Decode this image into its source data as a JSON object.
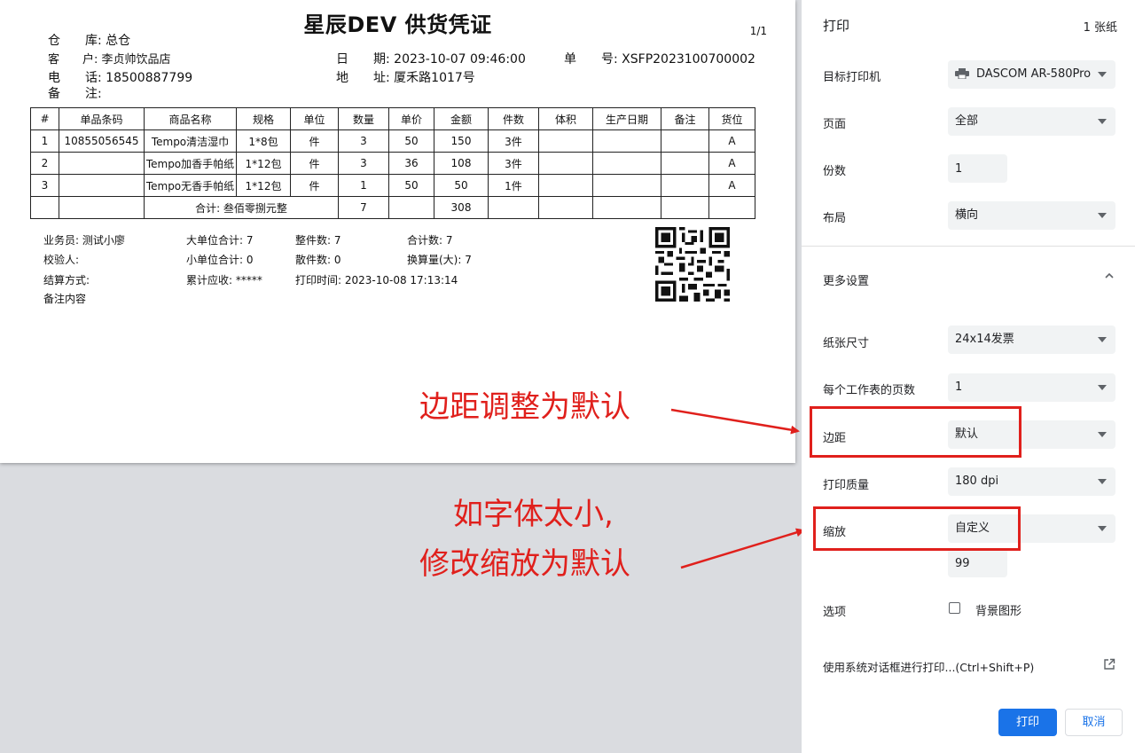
{
  "doc": {
    "title": "星辰DEV 供货凭证",
    "page": "1/1",
    "warehouse_label": "仓　　库:",
    "warehouse": "总仓",
    "customer_label": "客　　户:",
    "customer": "李贞帅饮品店",
    "phone_label": "电　　话:",
    "phone": "18500887799",
    "remark_label": "备　　注:",
    "date_label": "日　　期:",
    "date": "2023-10-07 09:46:00",
    "address_label": "地　　址:",
    "address": "厦禾路1017号",
    "order_label": "单　　号:",
    "order": "XSFP2023100700002",
    "columns": [
      "#",
      "单品条码",
      "商品名称",
      "规格",
      "单位",
      "数量",
      "单价",
      "金额",
      "件数",
      "体积",
      "生产日期",
      "备注",
      "货位"
    ],
    "rows": [
      [
        "1",
        "10855056545",
        "Tempo清洁湿巾",
        "1*8包",
        "件",
        "3",
        "50",
        "150",
        "3件",
        "",
        "",
        "",
        "A"
      ],
      [
        "2",
        "",
        "Tempo加香手帕纸",
        "1*12包",
        "件",
        "3",
        "36",
        "108",
        "3件",
        "",
        "",
        "",
        "A"
      ],
      [
        "3",
        "",
        "Tempo无香手帕纸",
        "1*12包",
        "件",
        "1",
        "50",
        "50",
        "1件",
        "",
        "",
        "",
        "A"
      ]
    ],
    "total_label": "合计: 叁佰零捌元整",
    "total_qty": "7",
    "total_amount": "308",
    "summary": {
      "salesman": "业务员: 测试小廖",
      "checker": "校验人:",
      "settle": "结算方式:",
      "note": "备注内容",
      "big_unit": "大单位合计: 7",
      "small_unit": "小单位合计: 0",
      "receivable": "累计应收: *****",
      "whole": "整件数: 7",
      "loose": "散件数: 0",
      "print_time": "打印时间: 2023-10-08 17:13:14",
      "total_count": "合计数: 7",
      "conv": "换算量(大): 7"
    }
  },
  "annotations": {
    "margin": "边距调整为默认",
    "zoom_line1": "如字体太小,",
    "zoom_line2": "修改缩放为默认"
  },
  "panel": {
    "title": "打印",
    "sheets": "1 张纸",
    "printer_label": "目标打印机",
    "printer_value": "DASCOM AR-580Pro",
    "pages_label": "页面",
    "pages_value": "全部",
    "copies_label": "份数",
    "copies_value": "1",
    "layout_label": "布局",
    "layout_value": "横向",
    "more_label": "更多设置",
    "paper_label": "纸张尺寸",
    "paper_value": "24x14发票",
    "persheet_label": "每个工作表的页数",
    "persheet_value": "1",
    "margin_label": "边距",
    "margin_value": "默认",
    "quality_label": "打印质量",
    "quality_value": "180 dpi",
    "scale_label": "缩放",
    "scale_value": "自定义",
    "scale_custom": "99",
    "options_label": "选项",
    "bg_label": "背景图形",
    "sys_dialog": "使用系统对话框进行打印...(Ctrl+Shift+P)",
    "print_btn": "打印",
    "cancel_btn": "取消"
  },
  "colors": {
    "accent": "#1a73e8",
    "annotation": "#e0201c"
  }
}
